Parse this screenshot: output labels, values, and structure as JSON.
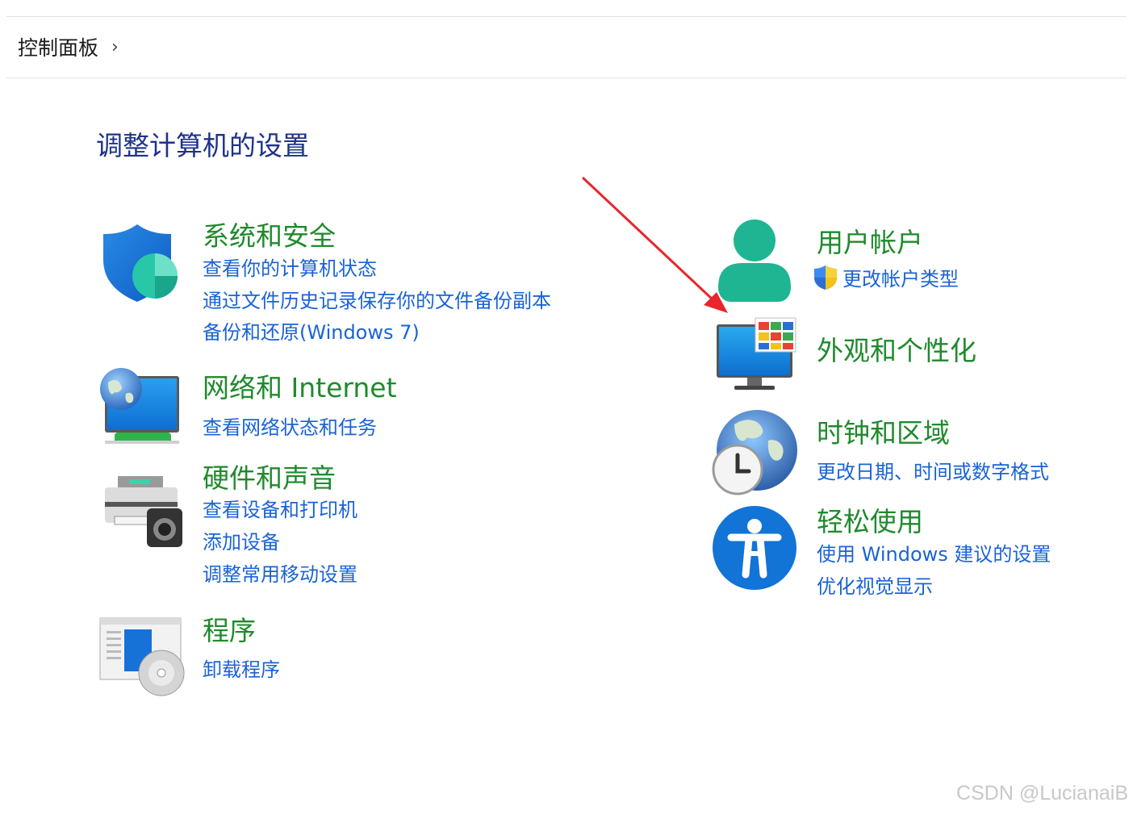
{
  "breadcrumb": {
    "root": "控制面板",
    "separator": "›"
  },
  "page_title": "调整计算机的设置",
  "categories": {
    "system_security": {
      "title": "系统和安全",
      "icon": "shield-icon",
      "links": [
        "查看你的计算机状态",
        "通过文件历史记录保存你的文件备份副本",
        "备份和还原(Windows 7)"
      ]
    },
    "network": {
      "title": "网络和 Internet",
      "icon": "network-globe-icon",
      "links": [
        "查看网络状态和任务"
      ]
    },
    "hardware": {
      "title": "硬件和声音",
      "icon": "printer-icon",
      "links": [
        "查看设备和打印机",
        "添加设备",
        "调整常用移动设置"
      ]
    },
    "programs": {
      "title": "程序",
      "icon": "programs-disc-icon",
      "links": [
        "卸载程序"
      ]
    },
    "user_accounts": {
      "title": "用户帐户",
      "icon": "user-icon",
      "links": [
        "更改帐户类型"
      ]
    },
    "appearance": {
      "title": "外观和个性化",
      "icon": "monitor-palette-icon",
      "links": []
    },
    "clock_region": {
      "title": "时钟和区域",
      "icon": "globe-clock-icon",
      "links": [
        "更改日期、时间或数字格式"
      ]
    },
    "ease_access": {
      "title": "轻松使用",
      "icon": "accessibility-icon",
      "links": [
        "使用 Windows 建议的设置",
        "优化视觉显示"
      ]
    }
  },
  "watermark": "CSDN @LucianaiB",
  "colors": {
    "category_title": "#1f8a2c",
    "link": "#1a63d6",
    "page_title": "#1e3287",
    "arrow": "#e8262b"
  }
}
